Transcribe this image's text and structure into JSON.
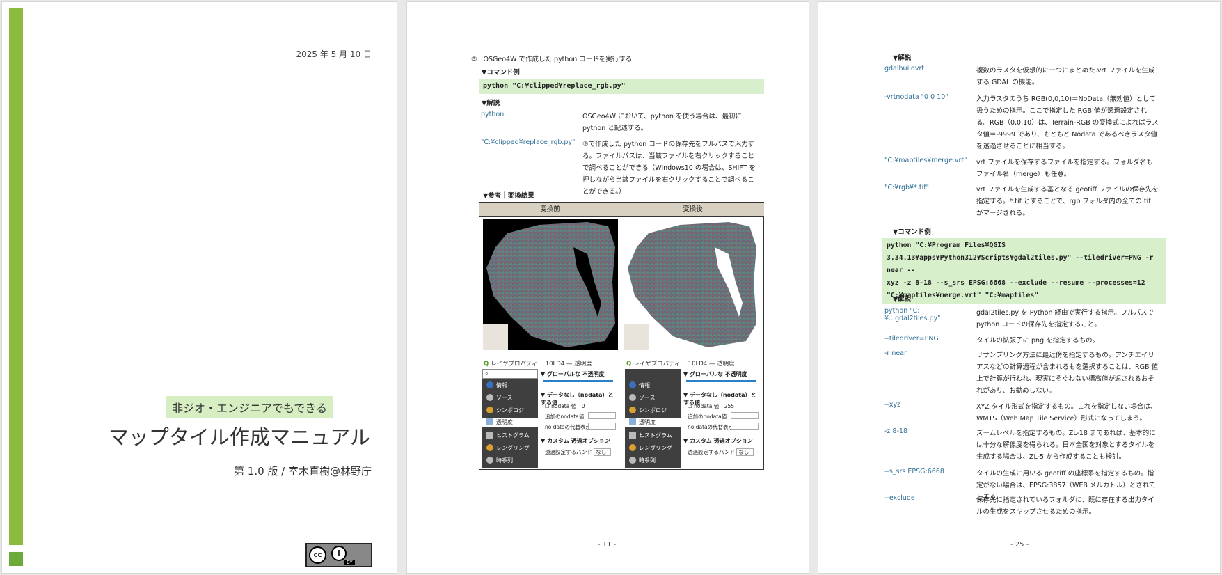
{
  "cover": {
    "date": "2025 年 5 月 10 日",
    "subtitle": "非ジオ・エンジニアでもできる",
    "title": "マップタイル作成マニュアル",
    "author": "第 1.0 版 / 室木直樹@林野庁",
    "license": {
      "cc": "cc",
      "by_glyph": "i",
      "by_text": "BY"
    }
  },
  "page11": {
    "step_num": "③",
    "step_text": "OSGeo4W で作成した python コードを実行する",
    "cmd_heading": "▼コマンド例",
    "cmd": "python \"C:¥clipped¥replace_rgb.py\"",
    "explain_heading": "▼解説",
    "defs": [
      {
        "term": "python",
        "desc": "OSGeo4W において、python を使う場合は、最初に python と記述する。"
      },
      {
        "term": "\"C:¥clipped¥replace_rgb.py\"",
        "desc": "②で作成した python コードの保存先をフルパスで入力する。ファイルパスは、当該ファイルを右クリックすることで調べることができる（Windows10 の場合は、SHIFT を押しながら当該ファイルを右クリックすることで調べることができる。）"
      }
    ],
    "ref_heading": "▼参考｜変換結果",
    "table": {
      "col_before": "変換前",
      "col_after": "変換後",
      "gis": {
        "title": "レイヤプロパティー 10LD4 — 透明度",
        "items": [
          "情報",
          "ソース",
          "シンボロジ",
          "透明度",
          "ヒストグラム",
          "レンダリング",
          "時系列"
        ],
        "sec_global": "グローバルな 不透明度",
        "sec_nodata": "データなし（nodata）とする値",
        "nodata_label": "nodata 値",
        "nodata_before": "0",
        "nodata_after": "255",
        "add_nodata": "追加のnodata値",
        "no_data_display": "no dataの代替表示",
        "sec_custom": "カスタム 透過オプション",
        "band_label": "透過設定するバンド",
        "band_value": "なし"
      }
    },
    "page_number": "- 11 -"
  },
  "page25": {
    "explain_heading_1": "▼解説",
    "defs1": [
      {
        "term": "gdalbuildvrt",
        "desc": "複数のラスタを仮想的に一つにまとめた.vrt ファイルを生成する GDAL の機能。"
      },
      {
        "term": "-vrtnodata \"0 0 10\"",
        "desc": "入力ラスタのうち RGB(0,0,10)＝NoData（無効値）として扱うための指示。ここで指定した RGB 値が透過設定される。RGB（0,0,10）は、Terrain-RGB の変換式によればラスタ値＝-9999 であり、もともと Nodata であるべきラスタ値を透過させることに相当する。"
      },
      {
        "term": "\"C:¥maptiles¥merge.vrt\"",
        "desc": "vrt ファイルを保存するファイルを指定する。フォルダ名もファイル名（merge）も任意。"
      },
      {
        "term": "\"C:¥rgb¥*.tif\"",
        "desc": "vrt ファイルを生成する基となる geotiff ファイルの保存先を指定する。*.tif とすることで、rgb フォルダ内の全ての tif がマージされる。"
      }
    ],
    "cmd_heading": "▼コマンド例",
    "cmd_lines": [
      "python \"C:¥Program Files¥QGIS",
      "3.34.13¥apps¥Python312¥Scripts¥gdal2tiles.py\" --tiledriver=PNG -r near --",
      "xyz -z 8-18 --s_srs EPSG:6668 --exclude --resume --processes=12",
      "\"C:¥maptiles¥merge.vrt\" \"C:¥maptiles\""
    ],
    "explain_heading_2": "▼解説",
    "defs2": [
      {
        "term": "python \"C:¥...gdal2tiles.py\"",
        "desc": "gdal2tiles.py を Python 経由で実行する指示。フルパスで python コードの保存先を指定すること。"
      },
      {
        "term": "--tiledriver=PNG",
        "desc": "タイルの拡張子に png を指定するもの。"
      },
      {
        "term": "-r near",
        "desc": "リサンプリング方法に最近傍を指定するもの。アンチエイリアスなどの計算過程が含まれるもを選択することは、RGB 値上で計算が行われ、現実にそぐわない標高値が返されるおそれがあり、お勧めしない。"
      },
      {
        "term": "--xyz",
        "desc": "XYZ タイル形式を指定するもの。これを指定しない場合は、WMTS（Web Map Tile Service）形式になってしまう。"
      },
      {
        "term": "-z 8-18",
        "desc": "ズームレベルを指定するもの。ZL-18 まであれば、基本的には十分な解像度を得られる。日本全国を対象とするタイルを生成する場合は、ZL-5 から作成することも検討。"
      },
      {
        "term": "--s_srs EPSG:6668",
        "desc": "タイルの生成に用いる geotiff の座標系を指定するもの。指定がない場合は、EPSG:3857（WEB メルカトル）とされてしまう。"
      },
      {
        "term": "--exclude",
        "desc": "保存先に指定されているフォルダに、既に存在する出力タイルの生成をスキップさせるための指示。"
      }
    ],
    "page_number": "- 25 -"
  },
  "colors": {
    "accent_green": "#8cba3d",
    "cmd_bg": "#d8efcc",
    "term_blue": "#2f6f95",
    "table_header": "#d8d0c0"
  }
}
